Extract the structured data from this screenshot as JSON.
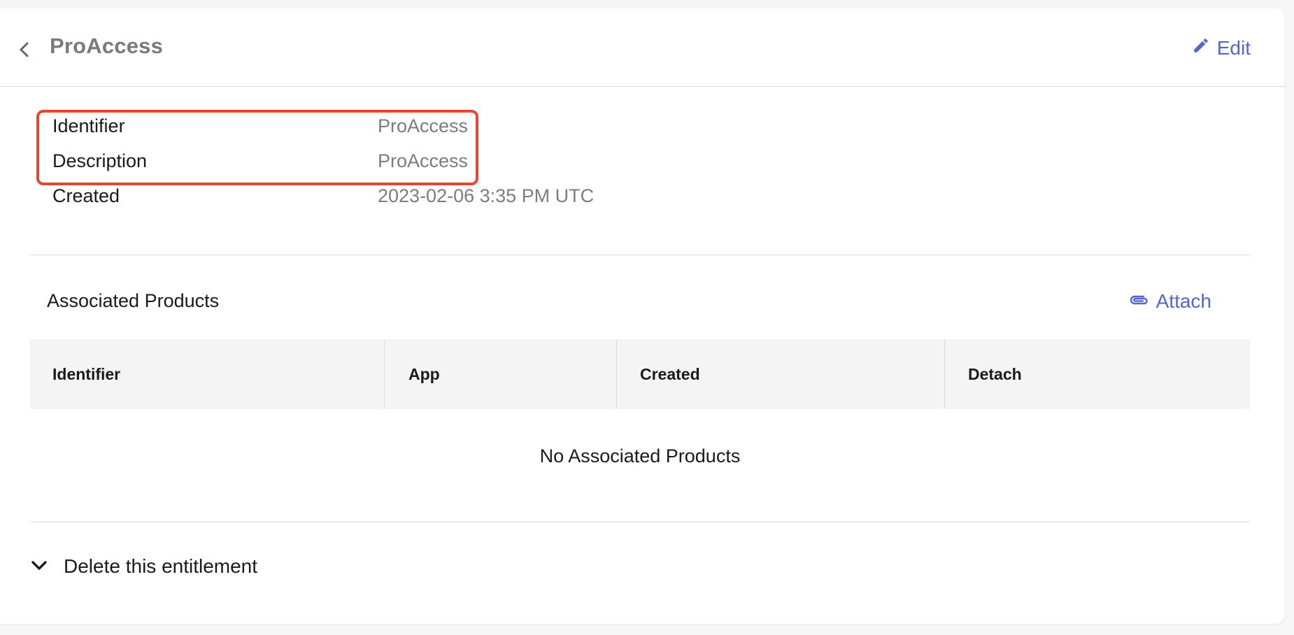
{
  "header": {
    "title": "ProAccess",
    "edit_label": "Edit"
  },
  "details": [
    {
      "label": "Identifier",
      "value": "ProAccess"
    },
    {
      "label": "Description",
      "value": "ProAccess"
    },
    {
      "label": "Created",
      "value": "2023-02-06 3:35 PM UTC"
    }
  ],
  "products": {
    "title": "Associated Products",
    "attach_label": "Attach",
    "columns": [
      "Identifier",
      "App",
      "Created",
      "Detach"
    ],
    "empty_message": "No Associated Products"
  },
  "danger": {
    "delete_label": "Delete this entitlement"
  },
  "colors": {
    "accent": "#5464d0",
    "highlight": "#e34832",
    "muted_text": "#7c7c7c"
  },
  "icons": [
    "chevron-left-icon",
    "pencil-icon",
    "paperclip-icon",
    "chevron-down-icon"
  ]
}
